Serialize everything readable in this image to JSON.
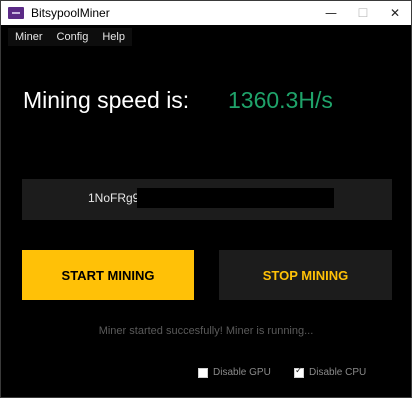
{
  "window": {
    "title": "BitsypoolMiner",
    "minimize": "—",
    "maximize": "☐",
    "close": "✕"
  },
  "menu": [
    "Miner",
    "Config",
    "Help"
  ],
  "speed": {
    "label": "Mining speed is:",
    "value": "1360.3H/s"
  },
  "address": {
    "visible_prefix": "1NoFRg9"
  },
  "buttons": {
    "start": "START MINING",
    "stop": "STOP MINING"
  },
  "status": "Miner started succesfully! Miner is running...",
  "options": {
    "disable_gpu": {
      "label": "Disable GPU",
      "checked": false
    },
    "disable_cpu": {
      "label": "Disable CPU",
      "checked": true
    }
  },
  "colors": {
    "accent": "#ffc107",
    "speed_value": "#1fa36a",
    "background": "#000000",
    "panel": "#1c1c1c"
  },
  "icons": {
    "app": "app-icon"
  }
}
